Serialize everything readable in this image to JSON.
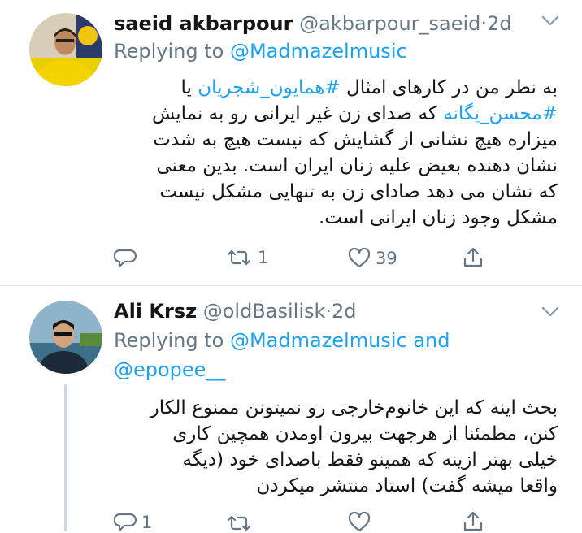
{
  "tweets": [
    {
      "display_name": "saeid akbarpour",
      "handle": "@akbarpour_saeid",
      "separator": "·",
      "time": "2d",
      "replying_prefix": "Replying to",
      "reply_to": [
        "@Madmazelmusic"
      ],
      "reply_joiner": "",
      "lines": [
        {
          "pre": "به نظر من در کارهای امثال ",
          "tag": "#همایون_شجریان",
          "post": " یا"
        },
        {
          "pre": "",
          "tag": "#محسن_یگانه",
          "post": " که صدای زن غیر ایرانی رو به نمایش"
        },
        {
          "pre": "میزاره هیچ نشانی از گشایش که نیست هیچ به شدت",
          "tag": "",
          "post": ""
        },
        {
          "pre": "نشان دهنده بعیض علیه زنان ایران است. بدین معنی",
          "tag": "",
          "post": ""
        },
        {
          "pre": "که نشان می دهد صادای زن به تنهایی مشکل نیست",
          "tag": "",
          "post": ""
        },
        {
          "pre": "مشکل وجود زنان ایرانی است.",
          "tag": "",
          "post": ""
        }
      ],
      "replies": "",
      "retweets": "1",
      "likes": "39"
    },
    {
      "display_name": "Ali Krsz",
      "handle": "@oldBasilisk",
      "separator": "·",
      "time": "2d",
      "replying_prefix": "Replying to",
      "reply_to": [
        "@Madmazelmusic",
        "@epopee__"
      ],
      "reply_joiner": "and",
      "lines": [
        {
          "pre": "بحث اینه که این خانوم‌خارجی رو نمیتونن ممنوع الکار",
          "tag": "",
          "post": ""
        },
        {
          "pre": "کنن، مطمئنا از هرجهت بیرون اومدن همچین کاری",
          "tag": "",
          "post": ""
        },
        {
          "pre": "خیلی بهتر ازینه که همینو فقط باصدای  خود (دیگه",
          "tag": "",
          "post": ""
        },
        {
          "pre": "واقعا میشه گفت) استاد منتشر میکردن",
          "tag": "",
          "post": ""
        }
      ],
      "replies": "1",
      "retweets": "",
      "likes": ""
    }
  ],
  "colors": {
    "accent": "#1da1f2",
    "muted": "#657786",
    "divider": "#e1e8ed"
  }
}
